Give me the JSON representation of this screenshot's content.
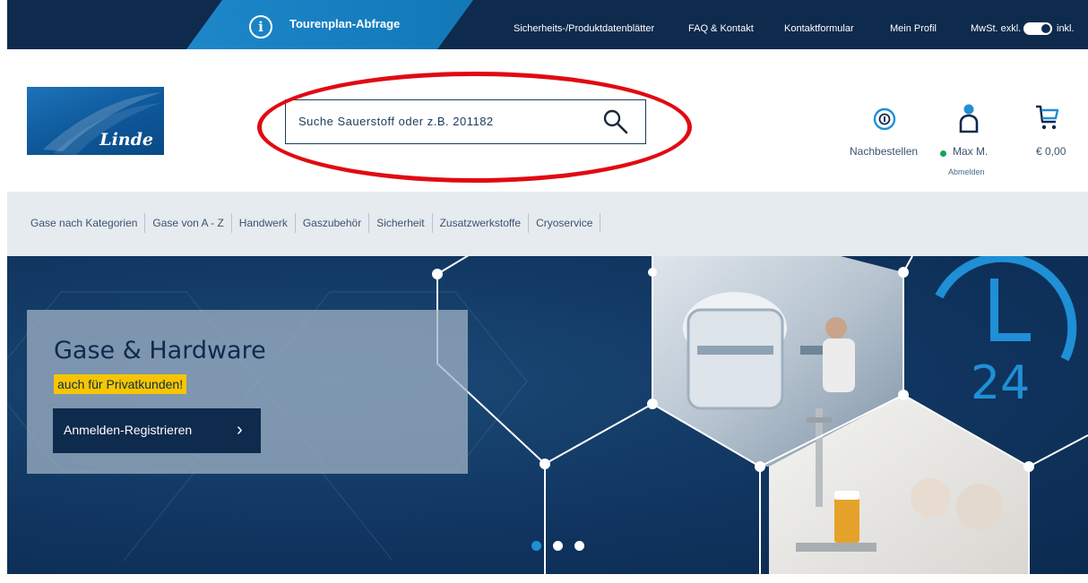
{
  "topbar": {
    "tour_label": "Tourenplan-Abfrage",
    "tour_icon": "info-icon",
    "links": [
      "Sicherheits-/Produktdatenblätter",
      "FAQ & Kontakt",
      "Kontaktformular",
      "Mein Profil"
    ],
    "vat_excl": "MwSt. exkl.",
    "vat_incl": "inkl.",
    "vat_toggle_state": "inkl"
  },
  "brand": {
    "logo_text": "Linde",
    "logo_color": "#0d5799"
  },
  "search": {
    "placeholder": "Suche   Sauerstoff   oder  z.B. 201182",
    "icon": "magnifier-icon",
    "highlight_color": "#e10a12"
  },
  "header": {
    "reorder_label": "Nachbestellen",
    "user_name": "Max M.",
    "logout_label": "Abmelden",
    "cart_total": "€ 0,00",
    "user_status_color": "#1aa35a"
  },
  "categories": [
    "Gase nach Kategorien",
    "Gase von A - Z",
    "Handwerk",
    "Gaszubehör",
    "Sicherheit",
    "Zusatzwerkstoffe",
    "Cryoservice"
  ],
  "hero": {
    "title": "Gase & Hardware",
    "tag": "auch für Privatkunden!",
    "button_label": "Anmelden-Registrieren",
    "clock_number": "24",
    "slides_total": 3,
    "active_slide": 1,
    "accent_color": "#1f8fd6",
    "tag_color": "#f7c600"
  }
}
